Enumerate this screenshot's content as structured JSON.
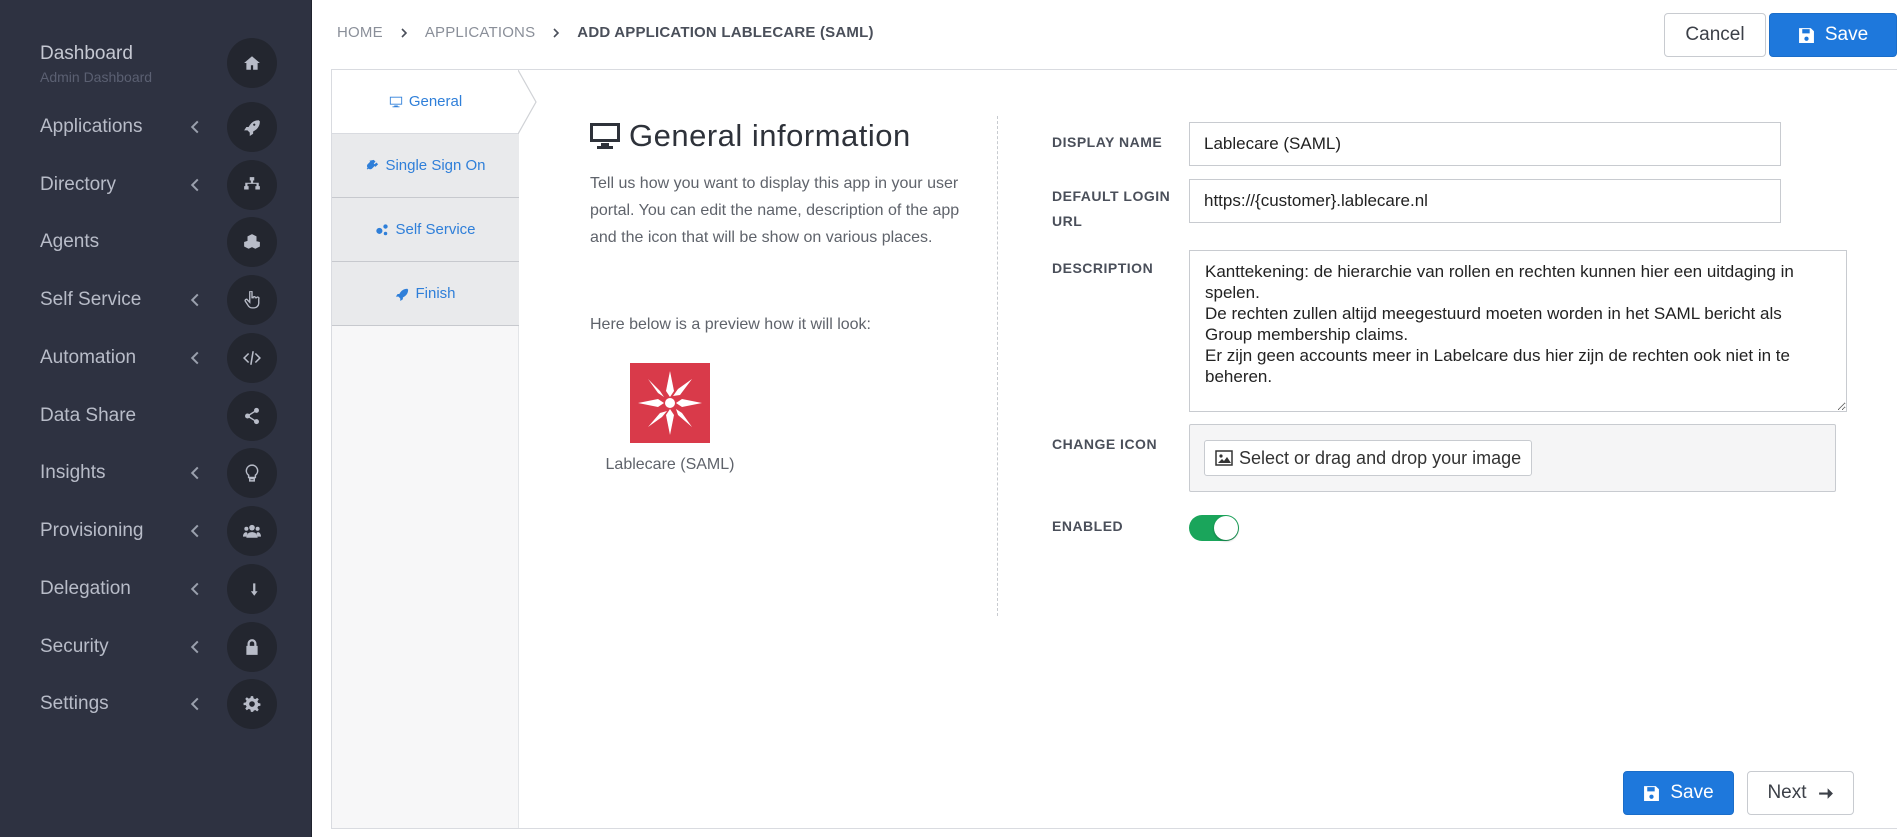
{
  "sidebar": {
    "dashboard": {
      "label": "Dashboard",
      "sub": "Admin Dashboard",
      "icon": "home-icon"
    },
    "items": [
      {
        "label": "Applications",
        "icon": "rocket-icon",
        "has_chevron": true
      },
      {
        "label": "Directory",
        "icon": "sitemap-icon",
        "has_chevron": true
      },
      {
        "label": "Agents",
        "icon": "cubes-icon",
        "has_chevron": false
      },
      {
        "label": "Self Service",
        "icon": "hand-pointer-icon",
        "has_chevron": true
      },
      {
        "label": "Automation",
        "icon": "code-icon",
        "has_chevron": true
      },
      {
        "label": "Data Share",
        "icon": "share-icon",
        "has_chevron": false
      },
      {
        "label": "Insights",
        "icon": "lightbulb-icon",
        "has_chevron": true
      },
      {
        "label": "Provisioning",
        "icon": "users-icon",
        "has_chevron": true
      },
      {
        "label": "Delegation",
        "icon": "level-down-icon",
        "has_chevron": true
      },
      {
        "label": "Security",
        "icon": "lock-icon",
        "has_chevron": true
      },
      {
        "label": "Settings",
        "icon": "gear-icon",
        "has_chevron": true
      }
    ]
  },
  "breadcrumb": {
    "home": "HOME",
    "applications": "APPLICATIONS",
    "current": "ADD APPLICATION LABLECARE (SAML)"
  },
  "header": {
    "cancel_label": "Cancel",
    "save_label": "Save"
  },
  "tabs": {
    "general": "General",
    "sso": "Single Sign On",
    "self_service": "Self Service",
    "finish": "Finish"
  },
  "general_info": {
    "title": "General information",
    "description": "Tell us how you want to display this app in your user portal. You can edit the name, description of the app and the icon that will be show on various places.",
    "preview_label": "Here below is a preview how it will look:",
    "app_name": "Lablecare (SAML)"
  },
  "form": {
    "display_name_label": "DISPLAY NAME",
    "display_name_value": "Lablecare (SAML)",
    "login_url_label": "DEFAULT LOGIN URL",
    "login_url_value": "https://{customer}.lablecare.nl",
    "description_label": "DESCRIPTION",
    "description_value": "Kanttekening: de hierarchie van rollen en rechten kunnen hier een uitdaging in spelen.\nDe rechten zullen altijd meegestuurd moeten worden in het SAML bericht als Group membership claims.\nEr zijn geen accounts meer in Labelcare dus hier zijn de rechten ook niet in te beheren.",
    "change_icon_label": "CHANGE ICON",
    "file_button_label": "Select or drag and drop your image",
    "enabled_label": "ENABLED",
    "enabled": true
  },
  "footer": {
    "save_label": "Save",
    "next_label": "Next"
  },
  "colors": {
    "sidebar_bg": "#2e3241",
    "accent": "#1e78dc",
    "toggle_on": "#1aa55b",
    "logo_bg": "#d93a4a"
  }
}
